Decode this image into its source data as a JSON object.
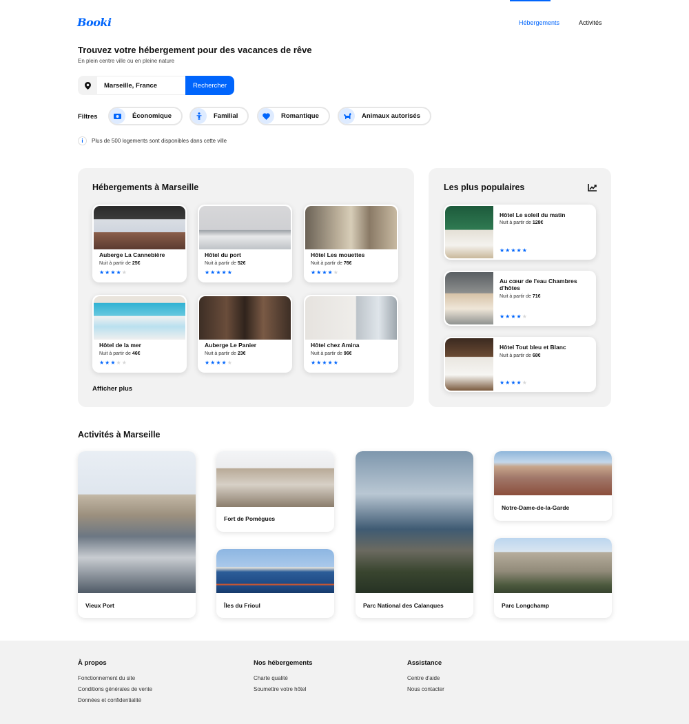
{
  "header": {
    "logo": "Booki",
    "nav": [
      {
        "label": "Hébergements",
        "active": true
      },
      {
        "label": "Activités",
        "active": false
      }
    ]
  },
  "hero": {
    "title": "Trouvez votre hébergement pour des vacances de rêve",
    "subtitle": "En plein centre ville ou en pleine nature"
  },
  "search": {
    "value": "Marseille, France",
    "button": "Rechercher",
    "icon": "map-pin-icon"
  },
  "filters": {
    "label": "Filtres",
    "items": [
      {
        "label": "Économique",
        "icon": "money-icon"
      },
      {
        "label": "Familial",
        "icon": "child-icon"
      },
      {
        "label": "Romantique",
        "icon": "heart-icon"
      },
      {
        "label": "Animaux autorisés",
        "icon": "dog-icon"
      }
    ]
  },
  "info": {
    "icon": "info-icon",
    "text": "Plus de 500 logements sont disponibles dans cette ville"
  },
  "hebergements": {
    "title": "Hébergements à Marseille",
    "show_more": "Afficher plus",
    "items": [
      {
        "name": "Auberge La Cannebière",
        "price_prefix": "Nuit à partir de",
        "price": "25€",
        "stars": 4
      },
      {
        "name": "Hôtel du port",
        "price_prefix": "Nuit à partir de",
        "price": "52€",
        "stars": 5
      },
      {
        "name": "Hôtel Les mouettes",
        "price_prefix": "Nuit à partir de",
        "price": "76€",
        "stars": 4
      },
      {
        "name": "Hôtel de la mer",
        "price_prefix": "Nuit à partir de",
        "price": "46€",
        "stars": 3
      },
      {
        "name": "Auberge Le Panier",
        "price_prefix": "Nuit à partir de",
        "price": "23€",
        "stars": 4
      },
      {
        "name": "Hôtel chez Amina",
        "price_prefix": "Nuit à partir de",
        "price": "96€",
        "stars": 5
      }
    ]
  },
  "populaires": {
    "title": "Les plus populaires",
    "icon": "trending-up-icon",
    "items": [
      {
        "name": "Hôtel Le soleil du matin",
        "price_prefix": "Nuit à partir de",
        "price": "128€",
        "stars": 5
      },
      {
        "name": "Au cœur de l'eau Chambres d'hôtes",
        "price_prefix": "Nuit à partir de",
        "price": "71€",
        "stars": 4
      },
      {
        "name": "Hôtel Tout bleu et Blanc",
        "price_prefix": "Nuit à partir de",
        "price": "68€",
        "stars": 4
      }
    ]
  },
  "activites": {
    "title": "Activités à Marseille",
    "items": [
      {
        "name": "Vieux Port"
      },
      {
        "name": "Fort de Pomègues"
      },
      {
        "name": "Îles du Frioul"
      },
      {
        "name": "Parc National des Calanques"
      },
      {
        "name": "Notre-Dame-de-la-Garde"
      },
      {
        "name": "Parc Longchamp"
      }
    ]
  },
  "footer": {
    "columns": [
      {
        "title": "À propos",
        "links": [
          "Fonctionnement du site",
          "Conditions générales de vente",
          "Données et confidentialité"
        ]
      },
      {
        "title": "Nos hébergements",
        "links": [
          "Charte qualité",
          "Soumettre votre hôtel"
        ]
      },
      {
        "title": "Assistance",
        "links": [
          "Centre d'aide",
          "Nous contacter"
        ]
      }
    ]
  },
  "colors": {
    "accent": "#0065FC",
    "accent_light": "#DEEBFF",
    "panel_bg": "#F2F2F2"
  }
}
